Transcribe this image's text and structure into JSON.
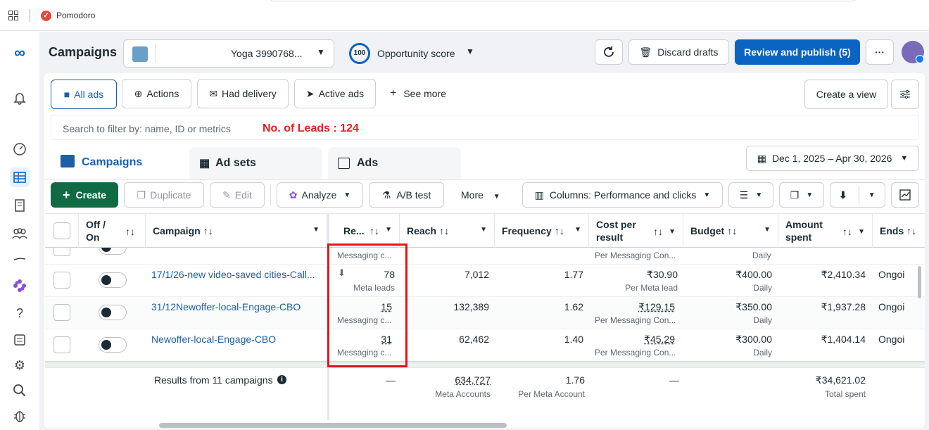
{
  "browser": {
    "tab_title": "Pomodoro"
  },
  "header": {
    "title": "Campaigns",
    "account_name": "Yoga 3990768...",
    "opportunity_score": "100",
    "opportunity_label": "Opportunity score",
    "discard_label": "Discard drafts",
    "publish_label": "Review and publish (5)",
    "more_label": "···"
  },
  "filters": {
    "all_ads": "All ads",
    "actions": "Actions",
    "had_delivery": "Had delivery",
    "active_ads": "Active ads",
    "see_more": "See more",
    "create_view": "Create a view"
  },
  "search": {
    "placeholder": "Search to filter by: name, ID or metrics",
    "annotation": "No. of Leads :  124"
  },
  "tabs": [
    {
      "label": "Campaigns"
    },
    {
      "label": "Ad sets"
    },
    {
      "label": "Ads"
    }
  ],
  "date_range": "Dec 1, 2025 – Apr 30, 2026",
  "toolbar": {
    "create": "Create",
    "duplicate": "Duplicate",
    "edit": "Edit",
    "analyze": "Analyze",
    "ab_test": "A/B test",
    "more": "More",
    "columns": "Columns: Performance and clicks"
  },
  "columns": {
    "onoff": "Off /\nOn",
    "campaign": "Campaign",
    "results": "Re...",
    "reach": "Reach",
    "frequency": "Frequency",
    "cost": "Cost per\nresult",
    "budget": "Budget",
    "amount": "Amount\nspent",
    "ends": "Ends"
  },
  "partial_row": {
    "results_sub": "Messaging c...",
    "cost_sub": "Per Messaging Con...",
    "budget_sub": "Daily"
  },
  "rows": [
    {
      "name": "17/1/26-new video-saved cities-Call...",
      "results": "78",
      "results_sub": "Meta leads",
      "reach": "7,012",
      "frequency": "1.77",
      "cost": "₹30.90",
      "cost_sub": "Per Meta lead",
      "budget": "₹400.00",
      "budget_sub": "Daily",
      "amount": "₹2,410.34",
      "ends": "Ongoi"
    },
    {
      "name": "31/12Newoffer-local-Engage-CBO",
      "results": "15",
      "results_sub": "Messaging c...",
      "reach": "132,389",
      "frequency": "1.62",
      "cost": "₹129.15",
      "cost_sub": "Per Messaging Con...",
      "budget": "₹350.00",
      "budget_sub": "Daily",
      "amount": "₹1,937.28",
      "ends": "Ongoi"
    },
    {
      "name": "Newoffer-local-Engage-CBO",
      "results": "31",
      "results_sub": "Messaging c...",
      "reach": "62,462",
      "frequency": "1.40",
      "cost": "₹45.29",
      "cost_sub": "Per Messaging Con...",
      "budget": "₹300.00",
      "budget_sub": "Daily",
      "amount": "₹1,404.14",
      "ends": "Ongoi"
    }
  ],
  "totals": {
    "label": "Results from 11 campaigns",
    "results": "—",
    "reach": "634,727",
    "reach_sub": "Meta Accounts",
    "frequency": "1.76",
    "frequency_sub": "Per Meta Account",
    "cost": "—",
    "amount": "₹34,621.02",
    "amount_sub": "Total spent"
  }
}
